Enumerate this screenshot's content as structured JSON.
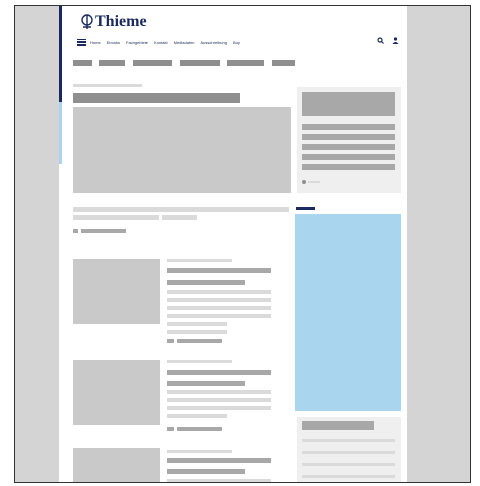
{
  "brand": {
    "name": "Thieme",
    "color": "#1a2a5e"
  },
  "nav": {
    "items": [
      "Home",
      "Ebooks",
      "Fachgebiete",
      "Kontakt",
      "Mediadaten",
      "Ausschreibung",
      "Buy"
    ]
  },
  "icons": {
    "menu": "hamburger-icon",
    "search": "search-icon",
    "user": "user-icon"
  },
  "colors": {
    "placeholder": "#c9c9c9",
    "ad": "#a9d6ee",
    "accent": "#1a2a5e"
  }
}
